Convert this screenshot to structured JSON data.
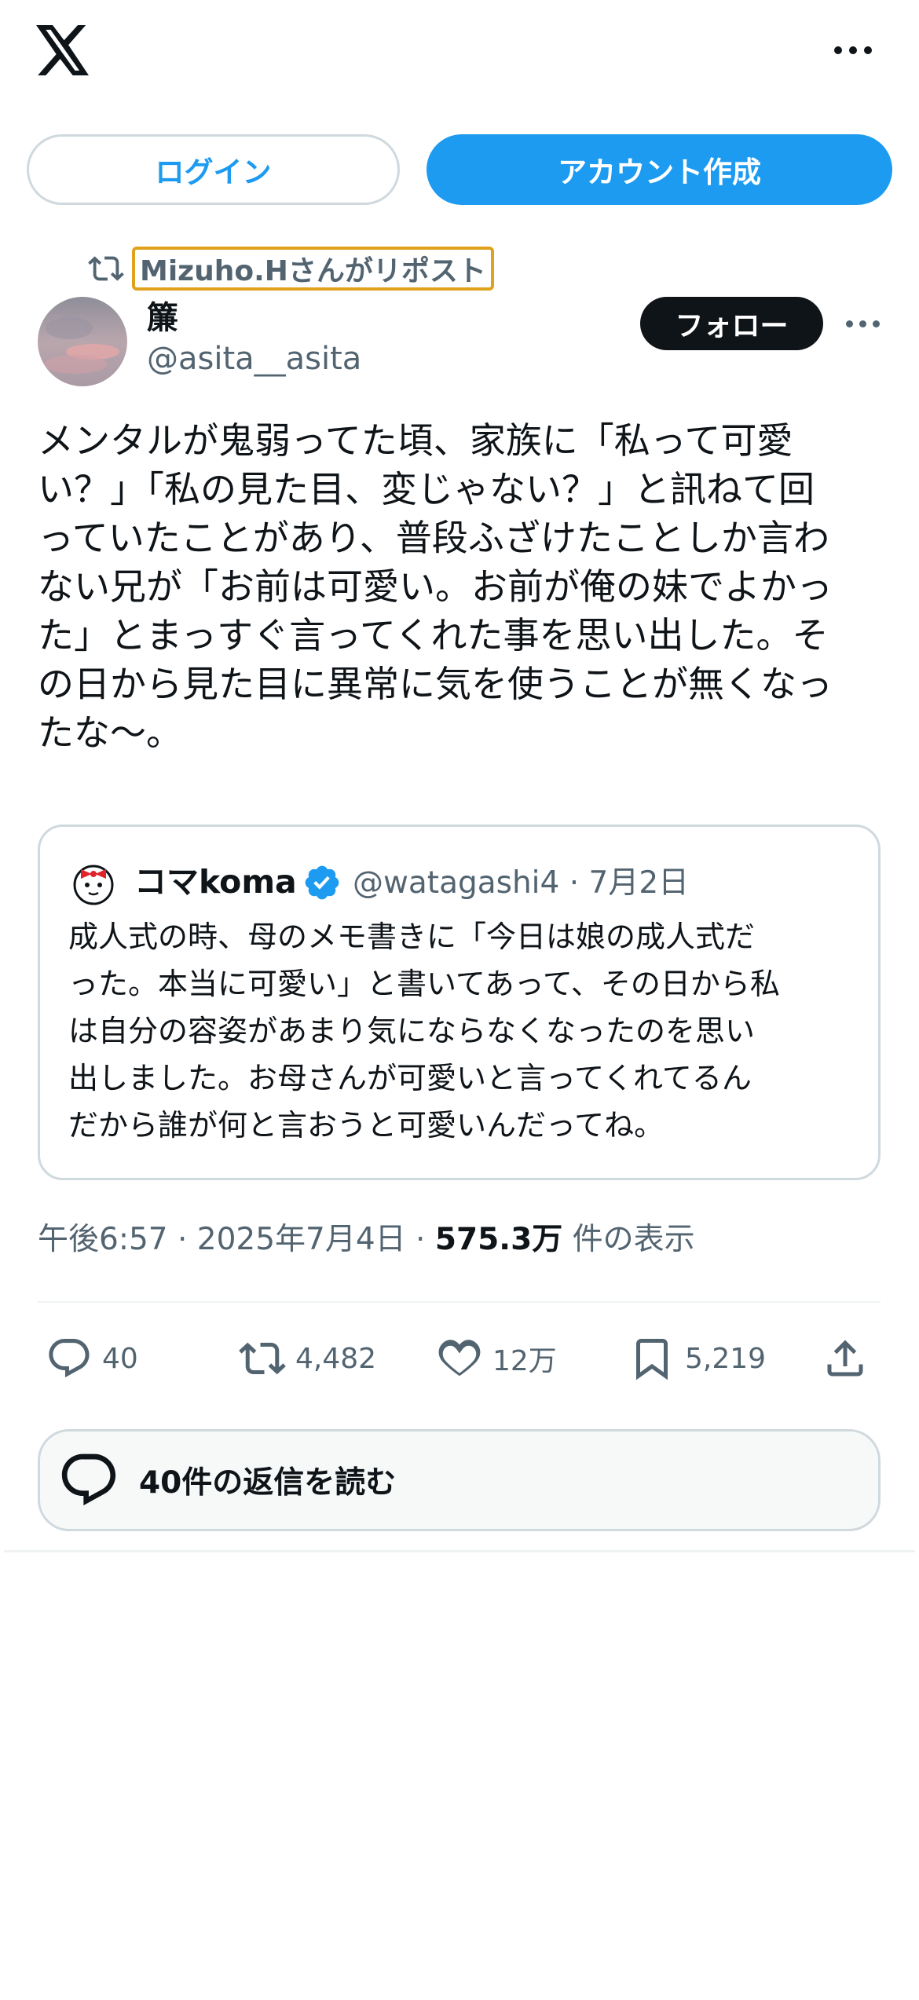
{
  "header": {
    "logo_icon": "x-logo-icon",
    "more_icon": "more-horizontal-icon",
    "login_label": "ログイン",
    "signup_label": "アカウント作成"
  },
  "post": {
    "repost_label": "Mizuho.Hさんがリポスト",
    "display_name": "簾",
    "handle": "@asita__asita",
    "follow_label": "フォロー",
    "text": "メンタルが鬼弱ってた頃、家族に「私って可愛\nい？」「私の見た目、変じゃない？」と訊ねて回\nっていたことがあり、普段ふざけたことしか言わ\nない兄が「お前は可愛い。お前が俺の妹でよかっ\nた」とまっすぐ言ってくれた事を思い出した。そ\nの日から見た目に異常に気を使うことが無くなっ\nたな〜。",
    "time": "午後6:57 · 2025年7月4日 · ",
    "views": "575.3万",
    "views_suffix": " 件の表示"
  },
  "quote": {
    "name": "コマkoma",
    "handle_date": "@watagashi4 · 7月2日",
    "text": "成人式の時、母のメモ書きに「今日は娘の成人式だ\nった。本当に可愛い」と書いてあって、その日から私\nは自分の容姿があまり気にならなくなったのを思い\n出しました。お母さんが可愛いと言ってくれてるん\nだから誰が何と言おうと可愛いんだってね。"
  },
  "actions": {
    "replies": "40",
    "reposts": "4,482",
    "likes": "12万",
    "bookmarks": "5,219"
  },
  "read_replies_label": "40件の返信を読む",
  "colors": {
    "accent": "#1d9bf0",
    "text": "#0f1419",
    "secondary": "#536471",
    "border": "#cfd9de",
    "highlight": "#e0a21b"
  }
}
